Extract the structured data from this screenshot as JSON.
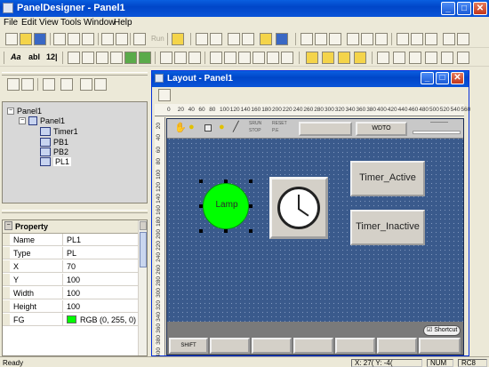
{
  "app": {
    "title": "PanelDesigner - Panel1",
    "colors": {
      "titlebar": "#0046c8",
      "canvas": "#3a5a8c",
      "lamp": "#00ff00",
      "window_bg": "#ece9d8"
    }
  },
  "window_controls": {
    "minimize": "_",
    "maximize": "□",
    "close": "✕"
  },
  "menu": [
    "File",
    "Edit",
    "View",
    "Tools",
    "Window",
    "Help"
  ],
  "toolbar1": {
    "run_label": "Run"
  },
  "toolbar2": {
    "aa_label": "Aa",
    "abl_label": "abl",
    "num_label": "12|"
  },
  "tree": {
    "root": "Panel1",
    "child": "Panel1",
    "items": [
      "Timer1",
      "PB1",
      "PB2",
      "PL1"
    ]
  },
  "property": {
    "header": "Property",
    "rows": [
      {
        "key": "Name",
        "value": "PL1"
      },
      {
        "key": "Type",
        "value": "PL"
      },
      {
        "key": "X",
        "value": "70"
      },
      {
        "key": "Y",
        "value": "100"
      },
      {
        "key": "Width",
        "value": "100"
      },
      {
        "key": "Height",
        "value": "100"
      },
      {
        "key": "FG",
        "value": "RGB (0, 255, 0)"
      }
    ]
  },
  "layout": {
    "title": "Layout - Panel1",
    "ruler_h": [
      "0",
      "20",
      "40",
      "60",
      "80",
      "100",
      "120",
      "140",
      "160",
      "180",
      "200",
      "220",
      "240",
      "260",
      "280",
      "300",
      "320",
      "340",
      "360",
      "380",
      "400",
      "420",
      "440",
      "460",
      "480",
      "500",
      "520",
      "540",
      "560"
    ],
    "ruler_v": [
      "20",
      "40",
      "60",
      "80",
      "100",
      "120",
      "140",
      "160",
      "180",
      "200",
      "220",
      "240",
      "260",
      "280",
      "300",
      "320",
      "340",
      "360",
      "380",
      "400"
    ],
    "wdto_label": "WDTO",
    "panel_top_small": [
      "SRUN",
      "STOP",
      "RESET",
      "P.E"
    ],
    "lamp_label": "Lamp",
    "timer_active": "Timer_Active",
    "timer_inactive": "Timer_Inactive",
    "shortcut_label": "Shortcut",
    "shift_label": "SHIFT"
  },
  "status": {
    "ready": "Ready",
    "coords": "X:   27( Y:   -4(",
    "num": "NUM",
    "rc": "RC8"
  }
}
